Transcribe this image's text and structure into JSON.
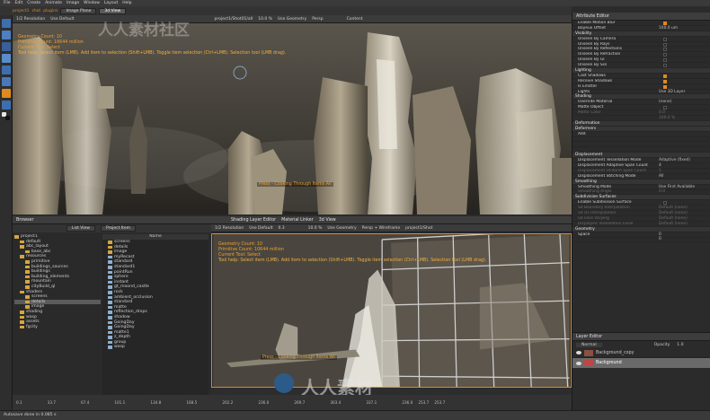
{
  "menubar": {
    "items": [
      "File",
      "Edit",
      "Create",
      "Animate",
      "Image",
      "Window",
      "Layout",
      "Help"
    ]
  },
  "top_toolbar": {
    "crumbs": [
      "project1",
      "shot",
      "plugins"
    ],
    "tabs": [
      "Image Plane",
      "3d View"
    ]
  },
  "top_viewport": {
    "header": [
      "1/2 Resolution",
      "Use Default",
      "project1/Shot01/all",
      "10.0 %",
      "Use Geometry",
      "Persp",
      "Content"
    ],
    "hud": {
      "geometry_count": "Geometry Count: 10",
      "primitive_count": "Primitive Count: 16644 million",
      "current_tool": "Current Tool: Select",
      "tool_help": "Tool help: Select item (LMB). Add item to selection (Shift+LMB). Toggle item selection (Ctrl+LMB). Selection tool (LMB drag)."
    },
    "center_msg": "Press - Cooking Through Items All"
  },
  "browser": {
    "title": "Browser",
    "modes": [
      "List View",
      "Project Item"
    ],
    "tree": [
      "project1",
      "default",
      "abc_layout",
      "base_abc",
      "resources",
      "primitive",
      "buildings_sources",
      "buildings",
      "building_elements",
      "mountain",
      "cityBuild_ql",
      "shaders",
      "screens",
      "details",
      "image",
      "shading",
      "wasp",
      "assets",
      "fgcity"
    ],
    "selected_index": 13,
    "file_header": "Name",
    "files": [
      "screens",
      "details",
      "image",
      "myRecast",
      "standard",
      "standard1",
      "pointRun",
      "sphere",
      "instant",
      "gt_moond_castle",
      "rock",
      "ambient_occlusion",
      "standard",
      "matte",
      "reflection_drops",
      "shadow",
      "GoingDay",
      "GoingDay",
      "matte1",
      "z_depth",
      "group",
      "wasp"
    ]
  },
  "bottom_viewport": {
    "tabs": [
      "Shading Layer Editor",
      "Material Linker",
      "3d View"
    ],
    "header": [
      "1/2 Resolution",
      "Use Default",
      "0.3",
      "10.0 %",
      "Use Geometry",
      "Persp + Wireframe",
      "project1/Shot"
    ],
    "hud": {
      "geometry_count": "Geometry Count: 10",
      "primitive_count": "Primitive Count: 10644 million",
      "current_tool": "Current Tool: Select",
      "tool_help": "Tool help: Select item (LMB). Add item to selection (Shift+LMB). Toggle item selection (Ctrl+LMB). Selection tool (LMB drag)."
    },
    "center_msg": "Press - Cooking Through Items All"
  },
  "timeline": {
    "ticks": [
      "0.1",
      "33.7",
      "67.4",
      "101.1",
      "134.8",
      "168.5",
      "202.2",
      "236.0",
      "269.7",
      "303.4",
      "337.1"
    ],
    "end_ticks": [
      "236.0",
      "253.7",
      "253.7"
    ]
  },
  "attribute_editor": {
    "title": "Attribute Editor",
    "rows": [
      {
        "type": "row",
        "label": "Enable Motion Blur",
        "check": true
      },
      {
        "type": "row",
        "label": "Bayeux Offset",
        "value": "100.0 um"
      },
      {
        "type": "section",
        "label": "Visibility"
      },
      {
        "type": "row",
        "label": "Unseen By Camera",
        "check": false
      },
      {
        "type": "row",
        "label": "Unseen By Rays",
        "check": false
      },
      {
        "type": "row",
        "label": "Unseen By Reflections",
        "check": false
      },
      {
        "type": "row",
        "label": "Unseen By Refraction",
        "check": false
      },
      {
        "type": "row",
        "label": "Unseen By GI",
        "check": false
      },
      {
        "type": "row",
        "label": "Unseen By Sss",
        "check": false
      },
      {
        "type": "section",
        "label": "Lighting"
      },
      {
        "type": "row",
        "label": "Cast Shadows",
        "check": true
      },
      {
        "type": "row",
        "label": "Receive Shadows",
        "check": true
      },
      {
        "type": "row",
        "label": "Is Emitter",
        "check": true
      },
      {
        "type": "row",
        "label": "Lights",
        "value": "Use 3D Layer"
      },
      {
        "type": "section",
        "label": "Shading"
      },
      {
        "type": "row",
        "label": "Override Material",
        "value": "(none)"
      },
      {
        "type": "row",
        "label": "Matte Object",
        "check": false
      },
      {
        "type": "dim",
        "label": "Matte Color",
        "value": "0.0"
      },
      {
        "type": "dim",
        "label": "",
        "value": "100.0 %"
      },
      {
        "type": "section",
        "label": "Deformation"
      },
      {
        "type": "section",
        "label": "Deformers"
      },
      {
        "type": "row",
        "label": "Add",
        "value": ""
      },
      {
        "type": "blank",
        "label": ""
      },
      {
        "type": "blank",
        "label": ""
      },
      {
        "type": "blank",
        "label": ""
      },
      {
        "type": "section",
        "label": "Displacement"
      },
      {
        "type": "row",
        "label": "Displacement Tessellation Mode",
        "value": "Adaptive (fixed)"
      },
      {
        "type": "row",
        "label": "Displacement Adaptive Span Count",
        "value": "4"
      },
      {
        "type": "dim",
        "label": "Displacement Uniform Span Count",
        "value": "1"
      },
      {
        "type": "row",
        "label": "Displacement Stitching Mode",
        "value": "All"
      },
      {
        "type": "section",
        "label": "Smoothing"
      },
      {
        "type": "row",
        "label": "Smoothing Mode",
        "value": "Use First Available"
      },
      {
        "type": "dim",
        "label": "Smoothing Angle",
        "value": "0.0"
      },
      {
        "type": "section",
        "label": "Subdivision Surfaces"
      },
      {
        "type": "row",
        "label": "Enable Subdivision Surface",
        "check": false
      },
      {
        "type": "dim",
        "label": "Sd Boundary Interpolation",
        "value": "Default (none)"
      },
      {
        "type": "dim",
        "label": "Sd Uv Interpolation",
        "value": "Default (none)"
      },
      {
        "type": "dim",
        "label": "Sd Face Varying",
        "value": "Default (none)"
      },
      {
        "type": "dim",
        "label": "Displayed Tessellation Level",
        "value": "Default (none)"
      },
      {
        "type": "section",
        "label": "Geometry"
      },
      {
        "type": "row",
        "label": "Space",
        "value": "0"
      },
      {
        "type": "row",
        "label": "",
        "value": "0"
      }
    ]
  },
  "layer_editor": {
    "title": "Layer Editor",
    "blend_mode": "Normal",
    "opacity_label": "Opacity",
    "opacity_value": "1.0",
    "layers": [
      "Background_copy",
      "Background"
    ]
  },
  "status_bar": {
    "text": "Autosave done in 0.085 s"
  },
  "watermarks": {
    "cn_top": "人人素材社区",
    "cn_bottom": "人人素材"
  },
  "colors": {
    "accent": "#e08a1e",
    "hud": "#f0a030",
    "sky": "#4f4a42",
    "grid": "#cfcfcf"
  }
}
